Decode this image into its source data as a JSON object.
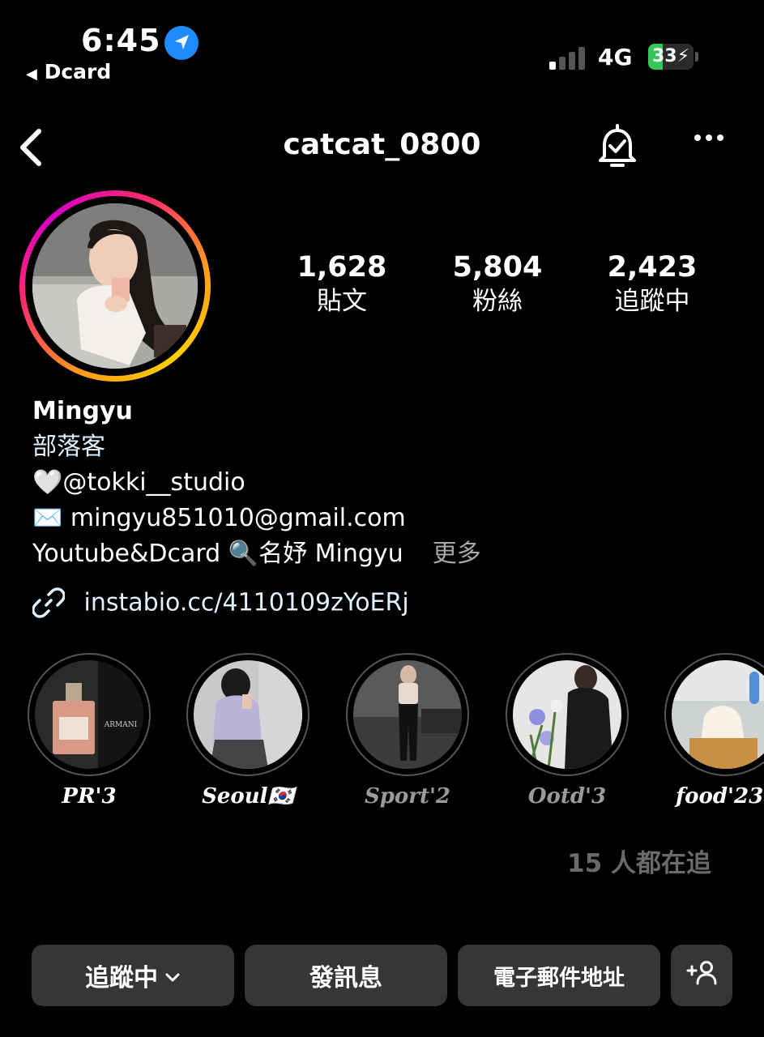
{
  "status_bar": {
    "time": "6:45",
    "back_app": "Dcard",
    "network": "4G",
    "battery": "33",
    "battery_level": 0.33
  },
  "nav": {
    "username": "catcat_0800"
  },
  "stats": [
    {
      "value": "1,628",
      "label": "貼文"
    },
    {
      "value": "5,804",
      "label": "粉絲"
    },
    {
      "value": "2,423",
      "label": "追蹤中"
    }
  ],
  "bio": {
    "name": "Mingyu",
    "category": "部落客",
    "line1_emoji": "🤍",
    "line1": "@tokki__studio",
    "line2_emoji": "✉️",
    "line2": "mingyu851010@gmail.com",
    "line3_a": "Youtube&Dcard",
    "line3_emoji": "🔍",
    "line3_b": "名妤 Mingyu",
    "more": "更多",
    "link": "instabio.cc/4110109zYoERj"
  },
  "highlights": [
    {
      "caption": "PR'3",
      "icon": "perfume-photo"
    },
    {
      "caption": "Seoul🇰🇷",
      "icon": "seoul-photo"
    },
    {
      "caption": "Sport'2",
      "icon": "gym-photo"
    },
    {
      "caption": "Ootd'3",
      "icon": "flowers-photo"
    },
    {
      "caption": "food'23",
      "icon": "dessert-photo"
    }
  ],
  "mutual": "15 人都在追",
  "actions": {
    "following": "追蹤中",
    "message": "發訊息",
    "email": "電子郵件地址"
  },
  "colors": {
    "link": "#e0f1ff",
    "button_bg": "#363636",
    "location_blue": "#1e8bff",
    "battery_green": "#35c759"
  }
}
